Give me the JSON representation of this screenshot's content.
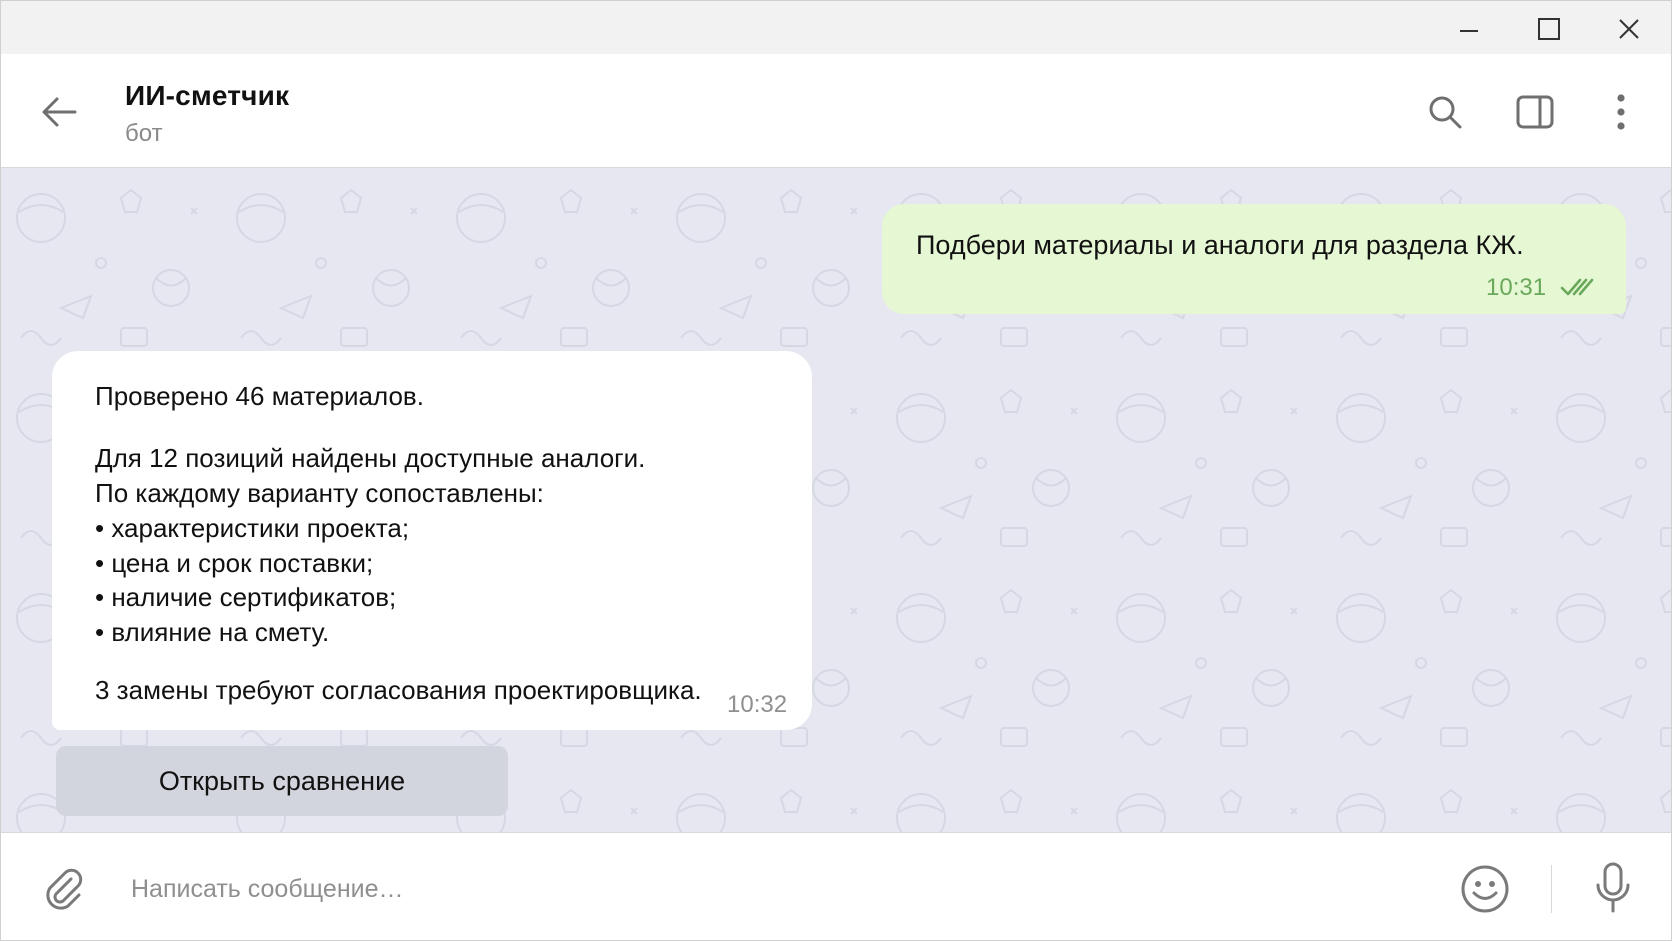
{
  "window": {
    "controls": {
      "minimize_icon": "minimize-icon",
      "maximize_icon": "maximize-icon",
      "close_icon": "close-icon"
    }
  },
  "header": {
    "title": "ИИ-сметчик",
    "subtitle": "бот",
    "icons": [
      "back-arrow-icon",
      "search-icon",
      "side-panel-icon",
      "more-vertical-icon"
    ]
  },
  "messages": {
    "outgoing": {
      "text": "Подбери материалы и аналоги для раздела КЖ.",
      "time": "10:31",
      "status_icon": "double-check-icon"
    },
    "incoming": {
      "line1": "Проверено 46 материалов.",
      "line2": "Для 12 позиций найдены доступные аналоги.",
      "line3": "По каждому варианту сопоставлены:",
      "bullets": [
        "• характеристики проекта;",
        "• цена и срок поставки;",
        "• наличие сертификатов;",
        "• влияние на смету."
      ],
      "line4": "3 замены требуют согласования проектировщика.",
      "time": "10:32"
    },
    "inline_button": "Открыть сравнение"
  },
  "composer": {
    "placeholder": "Написать сообщение…",
    "icons": [
      "paperclip-icon",
      "emoji-icon",
      "microphone-icon"
    ]
  },
  "colors": {
    "chat_background": "#e6e7f0",
    "outgoing_bubble": "#e6f7d4",
    "outgoing_time": "#6aa85a",
    "incoming_bubble": "#ffffff",
    "inline_button": "#d3d5de"
  }
}
